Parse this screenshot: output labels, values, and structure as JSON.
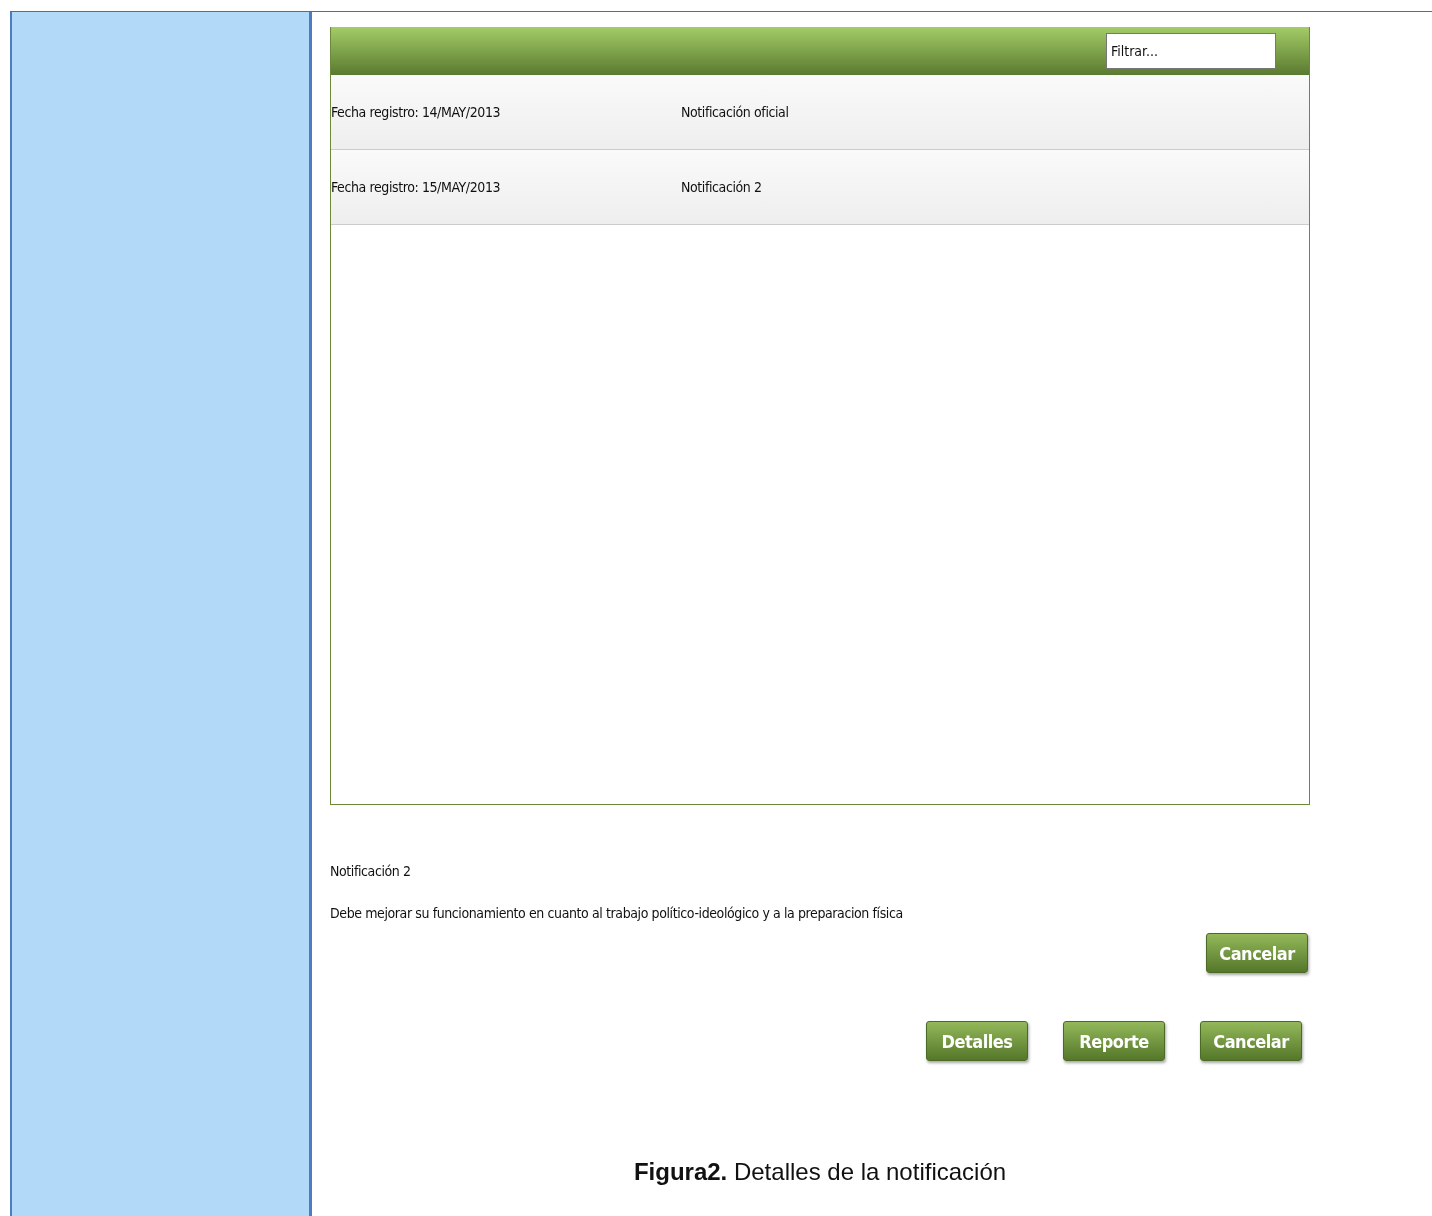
{
  "filter": {
    "placeholder": "Filtrar..."
  },
  "rows": [
    {
      "date": "Fecha registro: 14/MAY/2013",
      "title": "Notificación oficial"
    },
    {
      "date": "Fecha registro: 15/MAY/2013",
      "title": "Notificación 2"
    }
  ],
  "detail": {
    "title": "Notificación 2",
    "text": "Debe mejorar su funcionamiento en cuanto al trabajo político-ideológico y a la preparacion física",
    "button": "Cancelar"
  },
  "buttons": [
    "Detalles",
    "Reporte",
    "Cancelar"
  ],
  "caption": "**Figura2.** Detalles de la notificación"
}
